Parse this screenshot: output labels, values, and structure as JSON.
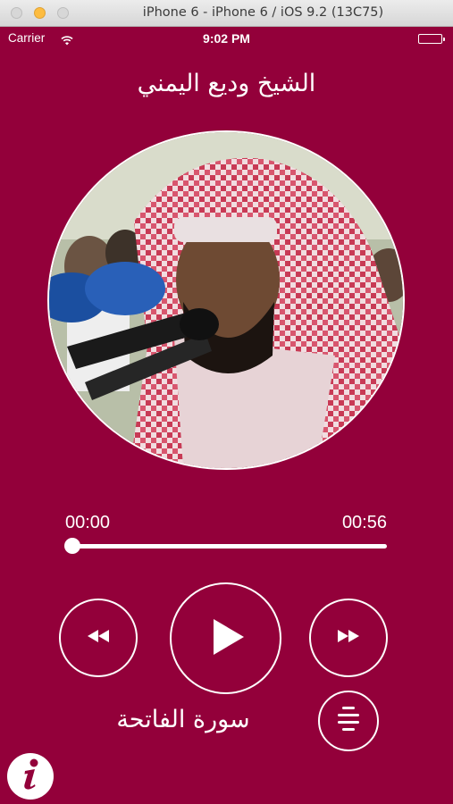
{
  "window": {
    "title": "iPhone 6 - iPhone 6 / iOS 9.2 (13C75)"
  },
  "status_bar": {
    "carrier": "Carrier",
    "time": "9:02 PM",
    "battery_level": 1.0
  },
  "player": {
    "reciter_name": "الشيخ وديع اليمني",
    "current_time": "00:00",
    "total_time": "00:56",
    "progress": 0.0,
    "surah_name": "سورة الفاتحة"
  },
  "colors": {
    "background": "#93003a",
    "foreground": "#ffffff"
  },
  "icons": {
    "rewind": "rewind-icon",
    "play": "play-icon",
    "forward": "fast-forward-icon",
    "list": "list-icon",
    "info": "info-icon",
    "wifi": "wifi-icon"
  }
}
